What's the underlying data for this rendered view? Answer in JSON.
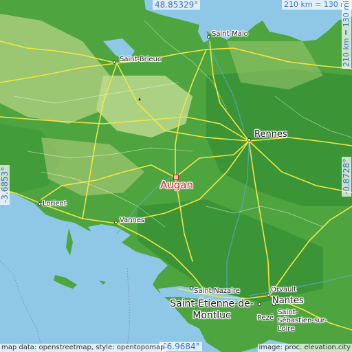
{
  "place": {
    "name": "Augan"
  },
  "coords": {
    "north": "48.85329°",
    "south": "46.9684°",
    "west": "-3.6853°",
    "east": "-0.8728°"
  },
  "scale": {
    "top": "210 km = 130 mi",
    "right": "210 km = 130 mi"
  },
  "cities": [
    {
      "id": "saint-malo",
      "name": "Saint-Malo",
      "size": "small"
    },
    {
      "id": "saint-brieuc",
      "name": "Saint-Brieuc",
      "size": "small"
    },
    {
      "id": "rennes",
      "name": "Rennes",
      "size": "large"
    },
    {
      "id": "lorient",
      "name": "Lorient",
      "size": "small"
    },
    {
      "id": "vannes",
      "name": "Vannes",
      "size": "small"
    },
    {
      "id": "saint-nazaire",
      "name": "Saint-Nazaire",
      "size": "small"
    },
    {
      "id": "orvault",
      "name": "Orvault",
      "size": "small"
    },
    {
      "id": "nantes",
      "name": "Nantes",
      "size": "large"
    },
    {
      "id": "saint-etienne",
      "name": "Saint-Étienne-de-Montluc",
      "size": "xlarge"
    },
    {
      "id": "reze",
      "name": "Rezé",
      "size": "small"
    },
    {
      "id": "saint-sebastien",
      "name": "Saint-Sébastien-sur-Loire",
      "size": "small"
    }
  ],
  "credits": {
    "left": "map data: openstreetmap, style: opentopomap",
    "right": "image: proc. elevation.city"
  },
  "colors": {
    "sea": "#8fc8e6",
    "lowland": "#3e9b3b",
    "midland": "#6fb14a",
    "upland": "#b9d68a",
    "road": "#f2e640",
    "accent": "#e21f1f"
  }
}
